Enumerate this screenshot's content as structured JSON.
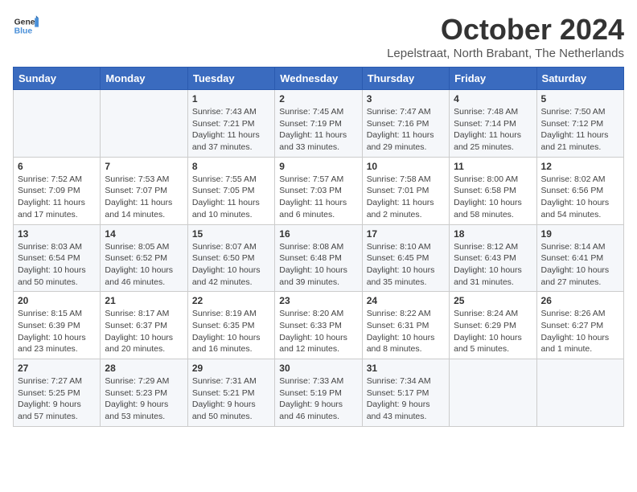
{
  "header": {
    "logo_line1": "General",
    "logo_line2": "Blue",
    "title": "October 2024",
    "subtitle": "Lepelstraat, North Brabant, The Netherlands"
  },
  "weekdays": [
    "Sunday",
    "Monday",
    "Tuesday",
    "Wednesday",
    "Thursday",
    "Friday",
    "Saturday"
  ],
  "weeks": [
    [
      {
        "day": "",
        "sunrise": "",
        "sunset": "",
        "daylight": ""
      },
      {
        "day": "",
        "sunrise": "",
        "sunset": "",
        "daylight": ""
      },
      {
        "day": "1",
        "sunrise": "Sunrise: 7:43 AM",
        "sunset": "Sunset: 7:21 PM",
        "daylight": "Daylight: 11 hours and 37 minutes."
      },
      {
        "day": "2",
        "sunrise": "Sunrise: 7:45 AM",
        "sunset": "Sunset: 7:19 PM",
        "daylight": "Daylight: 11 hours and 33 minutes."
      },
      {
        "day": "3",
        "sunrise": "Sunrise: 7:47 AM",
        "sunset": "Sunset: 7:16 PM",
        "daylight": "Daylight: 11 hours and 29 minutes."
      },
      {
        "day": "4",
        "sunrise": "Sunrise: 7:48 AM",
        "sunset": "Sunset: 7:14 PM",
        "daylight": "Daylight: 11 hours and 25 minutes."
      },
      {
        "day": "5",
        "sunrise": "Sunrise: 7:50 AM",
        "sunset": "Sunset: 7:12 PM",
        "daylight": "Daylight: 11 hours and 21 minutes."
      }
    ],
    [
      {
        "day": "6",
        "sunrise": "Sunrise: 7:52 AM",
        "sunset": "Sunset: 7:09 PM",
        "daylight": "Daylight: 11 hours and 17 minutes."
      },
      {
        "day": "7",
        "sunrise": "Sunrise: 7:53 AM",
        "sunset": "Sunset: 7:07 PM",
        "daylight": "Daylight: 11 hours and 14 minutes."
      },
      {
        "day": "8",
        "sunrise": "Sunrise: 7:55 AM",
        "sunset": "Sunset: 7:05 PM",
        "daylight": "Daylight: 11 hours and 10 minutes."
      },
      {
        "day": "9",
        "sunrise": "Sunrise: 7:57 AM",
        "sunset": "Sunset: 7:03 PM",
        "daylight": "Daylight: 11 hours and 6 minutes."
      },
      {
        "day": "10",
        "sunrise": "Sunrise: 7:58 AM",
        "sunset": "Sunset: 7:01 PM",
        "daylight": "Daylight: 11 hours and 2 minutes."
      },
      {
        "day": "11",
        "sunrise": "Sunrise: 8:00 AM",
        "sunset": "Sunset: 6:58 PM",
        "daylight": "Daylight: 10 hours and 58 minutes."
      },
      {
        "day": "12",
        "sunrise": "Sunrise: 8:02 AM",
        "sunset": "Sunset: 6:56 PM",
        "daylight": "Daylight: 10 hours and 54 minutes."
      }
    ],
    [
      {
        "day": "13",
        "sunrise": "Sunrise: 8:03 AM",
        "sunset": "Sunset: 6:54 PM",
        "daylight": "Daylight: 10 hours and 50 minutes."
      },
      {
        "day": "14",
        "sunrise": "Sunrise: 8:05 AM",
        "sunset": "Sunset: 6:52 PM",
        "daylight": "Daylight: 10 hours and 46 minutes."
      },
      {
        "day": "15",
        "sunrise": "Sunrise: 8:07 AM",
        "sunset": "Sunset: 6:50 PM",
        "daylight": "Daylight: 10 hours and 42 minutes."
      },
      {
        "day": "16",
        "sunrise": "Sunrise: 8:08 AM",
        "sunset": "Sunset: 6:48 PM",
        "daylight": "Daylight: 10 hours and 39 minutes."
      },
      {
        "day": "17",
        "sunrise": "Sunrise: 8:10 AM",
        "sunset": "Sunset: 6:45 PM",
        "daylight": "Daylight: 10 hours and 35 minutes."
      },
      {
        "day": "18",
        "sunrise": "Sunrise: 8:12 AM",
        "sunset": "Sunset: 6:43 PM",
        "daylight": "Daylight: 10 hours and 31 minutes."
      },
      {
        "day": "19",
        "sunrise": "Sunrise: 8:14 AM",
        "sunset": "Sunset: 6:41 PM",
        "daylight": "Daylight: 10 hours and 27 minutes."
      }
    ],
    [
      {
        "day": "20",
        "sunrise": "Sunrise: 8:15 AM",
        "sunset": "Sunset: 6:39 PM",
        "daylight": "Daylight: 10 hours and 23 minutes."
      },
      {
        "day": "21",
        "sunrise": "Sunrise: 8:17 AM",
        "sunset": "Sunset: 6:37 PM",
        "daylight": "Daylight: 10 hours and 20 minutes."
      },
      {
        "day": "22",
        "sunrise": "Sunrise: 8:19 AM",
        "sunset": "Sunset: 6:35 PM",
        "daylight": "Daylight: 10 hours and 16 minutes."
      },
      {
        "day": "23",
        "sunrise": "Sunrise: 8:20 AM",
        "sunset": "Sunset: 6:33 PM",
        "daylight": "Daylight: 10 hours and 12 minutes."
      },
      {
        "day": "24",
        "sunrise": "Sunrise: 8:22 AM",
        "sunset": "Sunset: 6:31 PM",
        "daylight": "Daylight: 10 hours and 8 minutes."
      },
      {
        "day": "25",
        "sunrise": "Sunrise: 8:24 AM",
        "sunset": "Sunset: 6:29 PM",
        "daylight": "Daylight: 10 hours and 5 minutes."
      },
      {
        "day": "26",
        "sunrise": "Sunrise: 8:26 AM",
        "sunset": "Sunset: 6:27 PM",
        "daylight": "Daylight: 10 hours and 1 minute."
      }
    ],
    [
      {
        "day": "27",
        "sunrise": "Sunrise: 7:27 AM",
        "sunset": "Sunset: 5:25 PM",
        "daylight": "Daylight: 9 hours and 57 minutes."
      },
      {
        "day": "28",
        "sunrise": "Sunrise: 7:29 AM",
        "sunset": "Sunset: 5:23 PM",
        "daylight": "Daylight: 9 hours and 53 minutes."
      },
      {
        "day": "29",
        "sunrise": "Sunrise: 7:31 AM",
        "sunset": "Sunset: 5:21 PM",
        "daylight": "Daylight: 9 hours and 50 minutes."
      },
      {
        "day": "30",
        "sunrise": "Sunrise: 7:33 AM",
        "sunset": "Sunset: 5:19 PM",
        "daylight": "Daylight: 9 hours and 46 minutes."
      },
      {
        "day": "31",
        "sunrise": "Sunrise: 7:34 AM",
        "sunset": "Sunset: 5:17 PM",
        "daylight": "Daylight: 9 hours and 43 minutes."
      },
      {
        "day": "",
        "sunrise": "",
        "sunset": "",
        "daylight": ""
      },
      {
        "day": "",
        "sunrise": "",
        "sunset": "",
        "daylight": ""
      }
    ]
  ]
}
